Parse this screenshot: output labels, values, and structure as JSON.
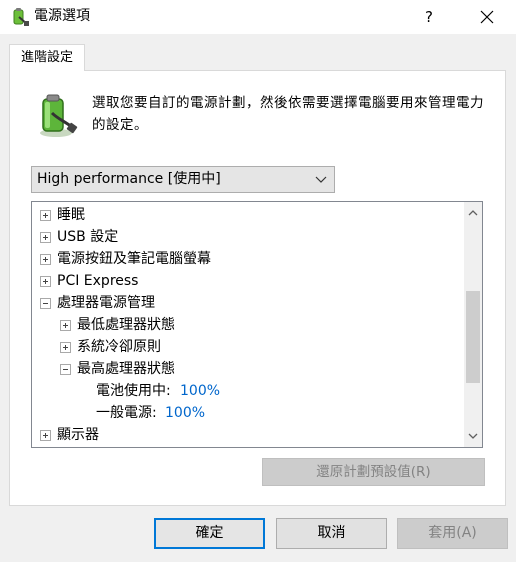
{
  "window": {
    "title": "電源選項",
    "help_label": "?"
  },
  "tab": {
    "label": "進階設定"
  },
  "description": "選取您要自訂的電源計劃，然後依需要選擇電腦要用來管理電力的設定。",
  "plan_select": {
    "value": "High performance [使用中]"
  },
  "tree": {
    "items": [
      {
        "label": "睡眠",
        "expander": "plus"
      },
      {
        "label": "USB 設定",
        "expander": "plus"
      },
      {
        "label": "電源按鈕及筆記電腦螢幕",
        "expander": "plus"
      },
      {
        "label": "PCI Express",
        "expander": "plus"
      },
      {
        "label": "處理器電源管理",
        "expander": "minus"
      },
      {
        "label": "最低處理器狀態",
        "expander": "plus"
      },
      {
        "label": "系統冷卻原則",
        "expander": "plus"
      },
      {
        "label": "最高處理器狀態",
        "expander": "minus"
      },
      {
        "label": "電池使用中:",
        "value": "100%"
      },
      {
        "label": "一般電源:",
        "value": "100%"
      },
      {
        "label": "顯示器",
        "expander": "plus"
      }
    ]
  },
  "restore_button": {
    "label": "還原計劃預設值(R)"
  },
  "buttons": {
    "ok": "確定",
    "cancel": "取消",
    "apply": "套用(A)"
  },
  "colors": {
    "accent": "#0078d7",
    "value_text": "#0066cc",
    "disabled_text": "#838383"
  }
}
